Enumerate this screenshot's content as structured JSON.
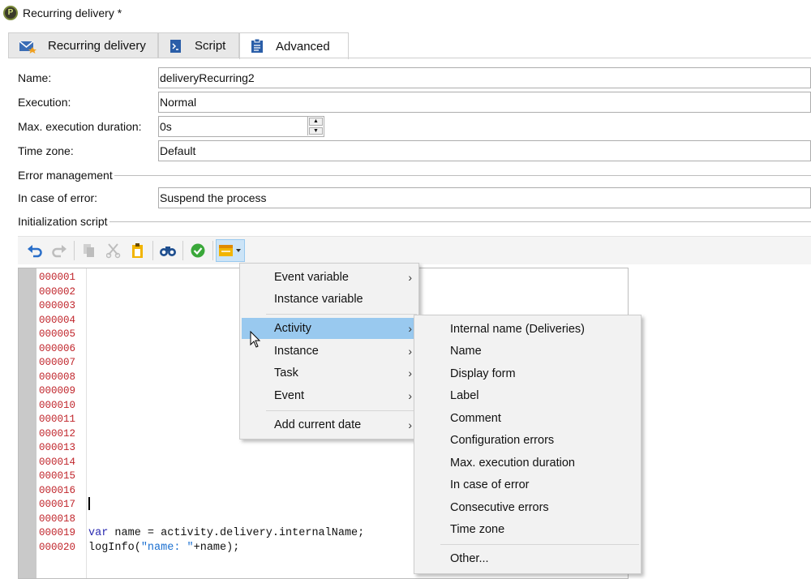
{
  "window": {
    "title": "Recurring delivery *",
    "icon": "app-logo-icon"
  },
  "tabs": [
    {
      "label": "Recurring delivery",
      "icon": "envelope-icon"
    },
    {
      "label": "Script",
      "icon": "script-icon"
    },
    {
      "label": "Advanced",
      "icon": "clipboard-icon"
    }
  ],
  "form": {
    "name_label": "Name:",
    "name_value": "deliveryRecurring2",
    "execution_label": "Execution:",
    "execution_value": "Normal",
    "max_duration_label": "Max. execution duration:",
    "max_duration_value": "0s",
    "timezone_label": "Time zone:",
    "timezone_value": "Default",
    "error_section": "Error management",
    "error_label": "In case of error:",
    "error_value": "Suspend the process",
    "init_section": "Initialization script"
  },
  "toolbar": {
    "buttons": [
      "undo-icon",
      "redo-icon",
      "copy-icon",
      "cut-icon",
      "paste-icon",
      "find-icon",
      "validate-icon",
      "insert-field-icon"
    ]
  },
  "editor": {
    "line_numbers": [
      "000001",
      "000002",
      "000003",
      "000004",
      "000005",
      "000006",
      "000007",
      "000008",
      "000009",
      "000010",
      "000011",
      "000012",
      "000013",
      "000014",
      "000015",
      "000016",
      "000017",
      "000018",
      "000019",
      "000020"
    ],
    "line19_kw": "var",
    "line19_rest": " name = activity.delivery.internalName;",
    "line20_a": "logInfo(",
    "line20_str": "\"name: \"",
    "line20_b": "+name);"
  },
  "menu": {
    "items": {
      "event_variable": "Event variable",
      "instance_variable": "Instance variable",
      "activity": "Activity",
      "instance": "Instance",
      "task": "Task",
      "event": "Event",
      "add_current_date": "Add current date"
    },
    "arrow": "›"
  },
  "submenu": {
    "items": {
      "internal_name": "Internal name (Deliveries)",
      "name": "Name",
      "display_form": "Display form",
      "label": "Label",
      "comment": "Comment",
      "config_errors": "Configuration errors",
      "max_duration": "Max. execution duration",
      "in_case_of_error": "In case of error",
      "consecutive_errors": "Consecutive errors",
      "time_zone": "Time zone",
      "other": "Other..."
    }
  },
  "colors": {
    "highlight": "#99c9ef",
    "line_number": "#c0242a",
    "keyword": "#2a2ab0"
  }
}
